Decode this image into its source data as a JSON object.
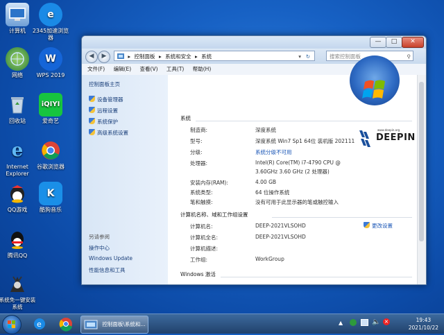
{
  "desktop": {
    "icons": [
      {
        "label": "计算机",
        "icon": "computer-icon"
      },
      {
        "label": "2345加速浏览器",
        "icon": "browser-2345-icon"
      },
      {
        "label": "网络",
        "icon": "network-icon"
      },
      {
        "label": "WPS 2019",
        "icon": "wps-icon"
      },
      {
        "label": "回收站",
        "icon": "recycle-bin-icon"
      },
      {
        "label": "爱奇艺",
        "icon": "iqiyi-icon"
      },
      {
        "label": "Internet Explorer",
        "icon": "ie-icon"
      },
      {
        "label": "谷歌浏览器",
        "icon": "chrome-icon"
      },
      {
        "label": "QQ游戏",
        "icon": "qq-game-icon"
      },
      {
        "label": "酷狗音乐",
        "icon": "kugou-icon"
      },
      {
        "label": "腾讯QQ",
        "icon": "qq-icon"
      },
      {
        "label": "系统免一键安装系统",
        "icon": "system-installer-icon"
      }
    ]
  },
  "window": {
    "controls": {
      "minimize": "—",
      "maximize": "□",
      "close": "✕"
    },
    "nav": {
      "back": "◀",
      "forward": "▶"
    },
    "address": {
      "segments": [
        "控制面板",
        "系统和安全",
        "系统"
      ],
      "separator": "▸"
    },
    "search_placeholder": "搜索控制面板",
    "menu": [
      "文件(F)",
      "编辑(E)",
      "查看(V)",
      "工具(T)",
      "帮助(H)"
    ],
    "left_pane": {
      "home": "控制面板主页",
      "links": [
        "设备管理器",
        "远程设置",
        "系统保护",
        "高级系统设置"
      ],
      "see_also_title": "另请参阅",
      "see_also": [
        "操作中心",
        "Windows Update",
        "性能信息和工具"
      ]
    },
    "system": {
      "section_title": "系统",
      "rows": [
        {
          "label": "制造商:",
          "value": "深度系统"
        },
        {
          "label": "型号:",
          "value": "深度系统 Win7 Sp1 64位 装机版 202111"
        },
        {
          "label": "分级:",
          "value": "系统分级不可用"
        },
        {
          "label": "处理器:",
          "value": "Intel(R) Core(TM) i7-4790 CPU @",
          "value2": "3.60GHz   3.60 GHz  (2 处理器)"
        },
        {
          "label": "安装内存(RAM):",
          "value": "4.00 GB"
        },
        {
          "label": "系统类型:",
          "value": "64 位操作系统"
        },
        {
          "label": "笔和触摸:",
          "value": "没有可用于此显示器的笔或触控输入"
        }
      ],
      "oem_logo_text": "DEEPIN",
      "oem_logo_small": "www.deepin.org"
    },
    "computer": {
      "section_title": "计算机名称、域和工作组设置",
      "rows": [
        {
          "label": "计算机名:",
          "value": "DEEP-2021VLSOHD"
        },
        {
          "label": "计算机全名:",
          "value": "DEEP-2021VLSOHD"
        },
        {
          "label": "计算机描述:",
          "value": ""
        },
        {
          "label": "工作组:",
          "value": "WorkGroup"
        }
      ],
      "change_settings": "更改设置"
    },
    "activation": {
      "section_title": "Windows 激活"
    }
  },
  "taskbar": {
    "task_label": "控制面板\\系统和...",
    "time": "19:43",
    "date": "2021/10/22"
  },
  "colors": {
    "desktop": "#1761c4",
    "link": "#1a56b6",
    "taskbar": "#20416b"
  }
}
